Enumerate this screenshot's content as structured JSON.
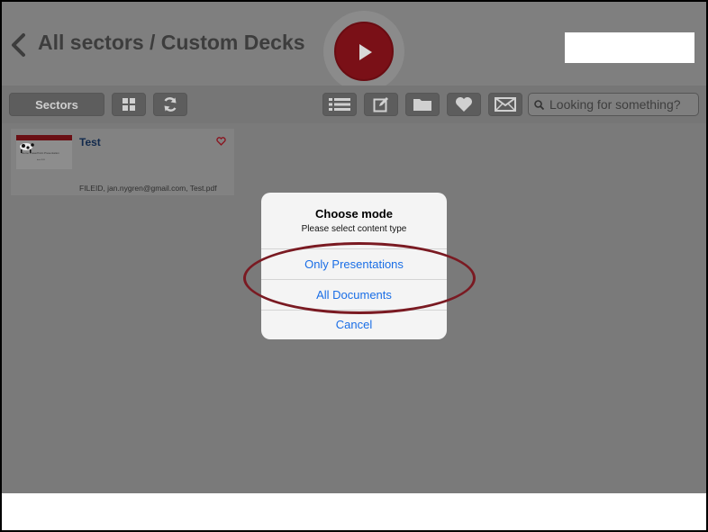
{
  "header": {
    "title": "All sectors / Custom Decks"
  },
  "toolbar": {
    "sectors_label": "Sectors",
    "search_placeholder": "Looking for something?"
  },
  "card": {
    "title": "Test",
    "thumb_title": "Demo PowerPoint Presentation",
    "thumb_subtitle": "date 2015",
    "meta": "FILEID, jan.nygren@gmail.com, Test.pdf"
  },
  "dialog": {
    "title": "Choose mode",
    "message": "Please select content type",
    "options": [
      "Only Presentations",
      "All Documents"
    ],
    "cancel": "Cancel"
  },
  "colors": {
    "accent_red": "#7a1017",
    "link_blue": "#1a6ee6"
  }
}
